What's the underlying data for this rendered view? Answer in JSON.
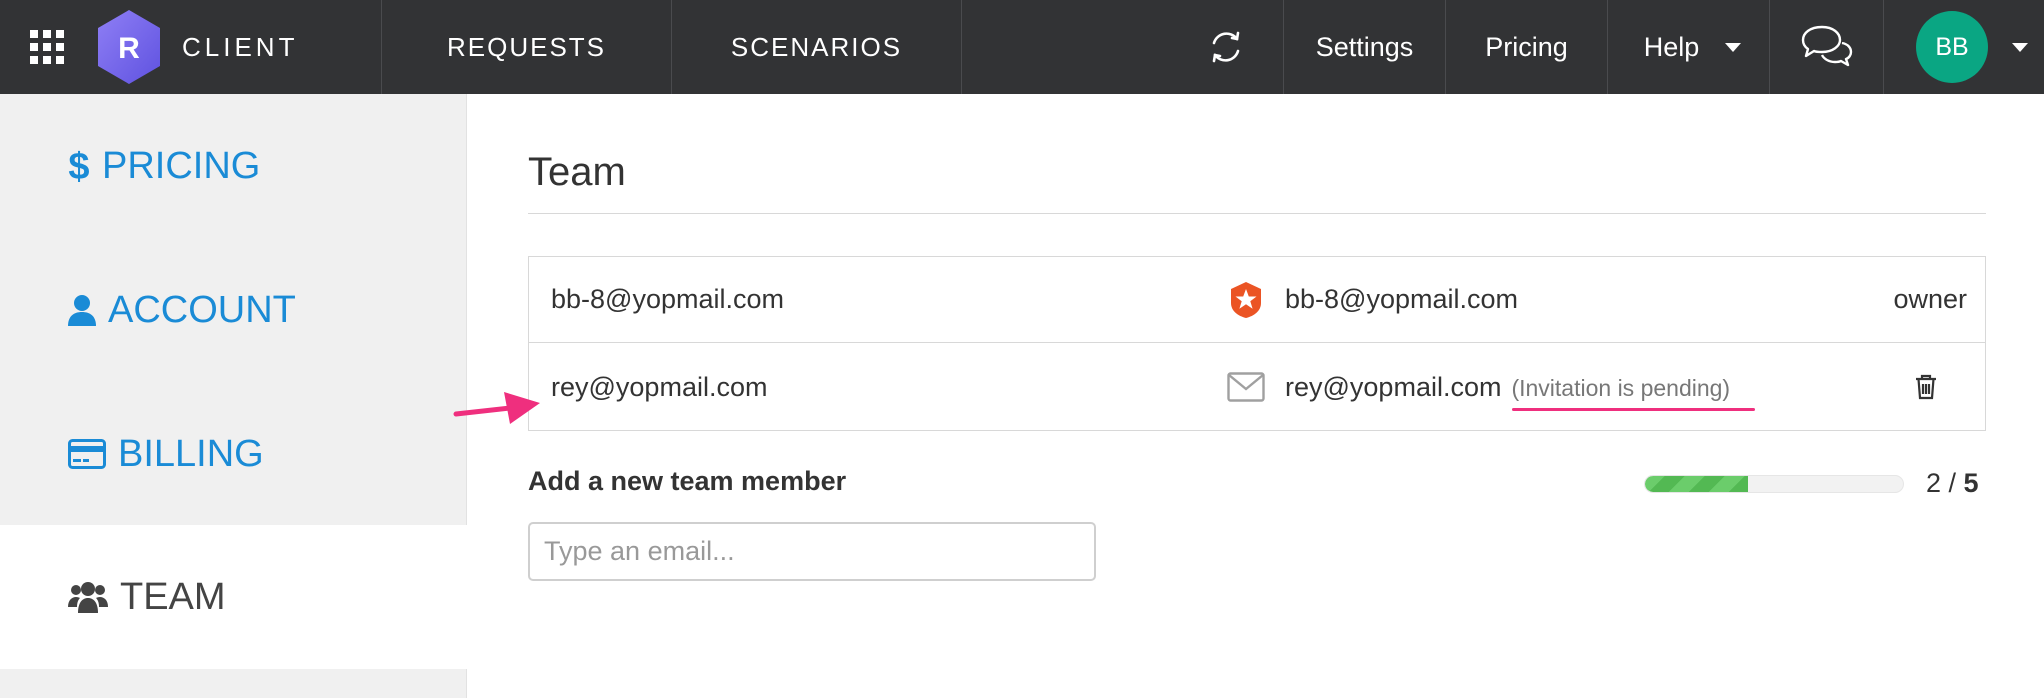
{
  "colors": {
    "topbar_bg": "#323335",
    "sidebar_bg": "#f0f0f0",
    "link_blue": "#1a8bd6",
    "avatar_green": "#0aa683",
    "logo_purple": "#7b6cf0",
    "annotation_pink": "#ef2f7e",
    "progress_green": "#5cc45c"
  },
  "topbar": {
    "apps_icon": "grid-icon",
    "logo_letter": "R",
    "brand": "CLIENT",
    "nav": [
      {
        "label": "REQUESTS"
      },
      {
        "label": "SCENARIOS"
      }
    ],
    "sync_icon": "sync-icon",
    "links": {
      "settings": "Settings",
      "pricing": "Pricing",
      "help": "Help"
    },
    "chat_icon": "chat-bubbles-icon",
    "user_initials": "BB"
  },
  "sidebar": {
    "items": [
      {
        "label": "PRICING",
        "icon": "dollar-icon"
      },
      {
        "label": "ACCOUNT",
        "icon": "user-icon"
      },
      {
        "label": "BILLING",
        "icon": "credit-card-icon"
      },
      {
        "label": "TEAM",
        "icon": "users-icon",
        "active": true
      }
    ]
  },
  "main": {
    "title": "Team",
    "members": [
      {
        "email": "bb-8@yopmail.com",
        "provider_icon": "auth0-icon",
        "provider_email": "bb-8@yopmail.com",
        "role": "owner",
        "status": ""
      },
      {
        "email": "rey@yopmail.com",
        "provider_icon": "envelope-icon",
        "provider_email": "rey@yopmail.com",
        "role": "",
        "status": "(Invitation is pending)"
      }
    ],
    "add_label": "Add a new team member",
    "email_placeholder": "Type an email...",
    "seats_used": "2",
    "seats_total": "5",
    "seats_separator": " / ",
    "progress_fraction": 0.4
  }
}
